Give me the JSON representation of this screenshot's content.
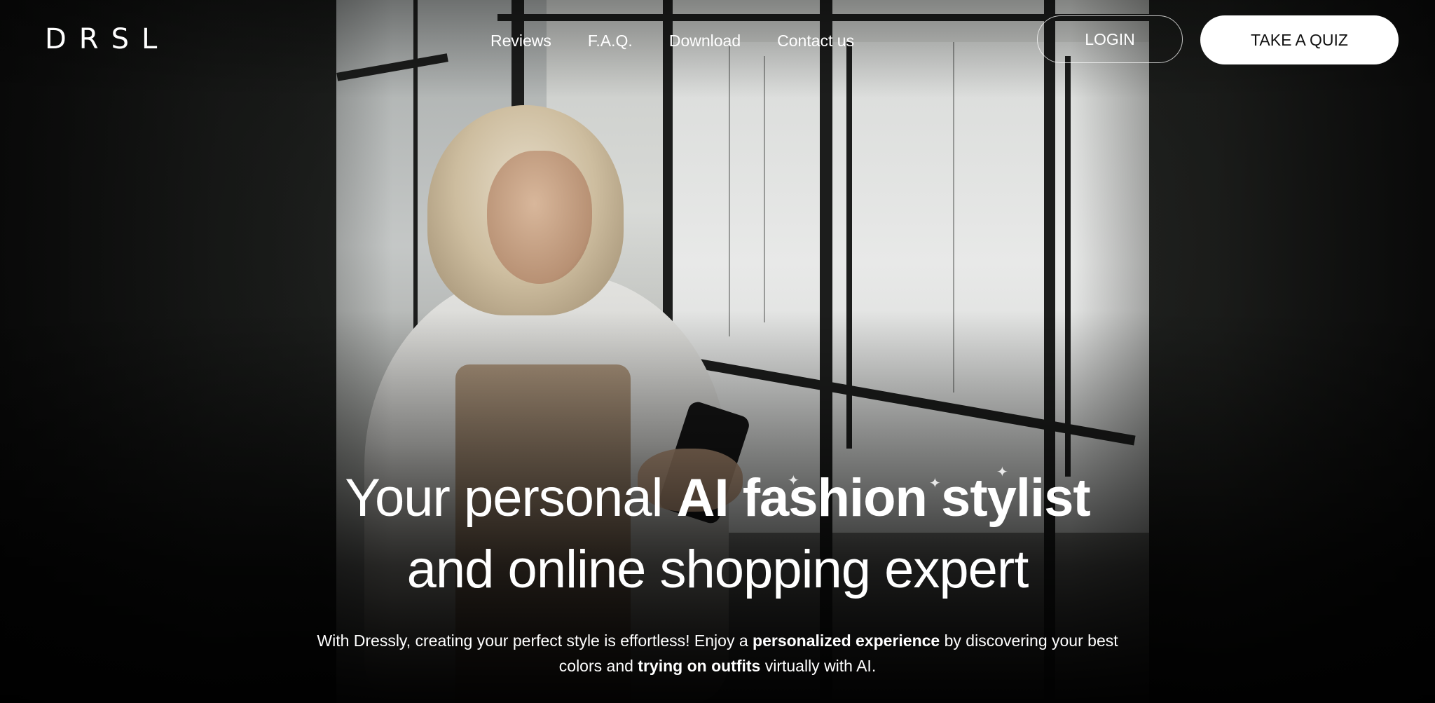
{
  "header": {
    "logo": "DRSL",
    "nav": [
      {
        "label": "Reviews"
      },
      {
        "label": "F.A.Q."
      },
      {
        "label": "Download"
      },
      {
        "label": "Contact us"
      }
    ],
    "login_label": "LOGIN",
    "quiz_label": "TAKE A QUIZ"
  },
  "hero": {
    "headline_line1_light": "Your personal ",
    "headline_line1_bold": "AI fashion stylist",
    "headline_line2": "and online shopping expert",
    "sub_part1": "With Dressly, creating your perfect style is effortless! Enjoy a ",
    "sub_bold1": "personalized experience",
    "sub_part2": " by discovering your best colors and ",
    "sub_bold2": "trying on outfits",
    "sub_part3": " virtually with AI."
  },
  "colors": {
    "text": "#ffffff",
    "quiz_button_bg": "#ffffff",
    "quiz_button_text": "#111111"
  }
}
